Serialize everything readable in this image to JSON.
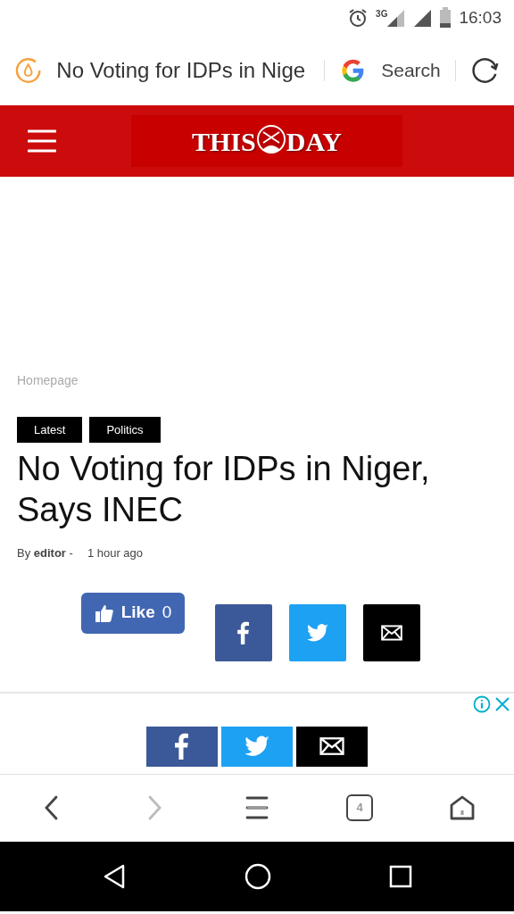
{
  "status_bar": {
    "network": "3G",
    "time": "16:03"
  },
  "address_bar": {
    "title": "No Voting for IDPs in Nige",
    "search": "Search"
  },
  "site_header": {
    "logo_left": "THIS",
    "logo_right": "DAY"
  },
  "breadcrumb": "Homepage",
  "tags": [
    "Latest",
    "Politics"
  ],
  "title": "No Voting for IDPs in Niger, Says INEC",
  "byline": {
    "author": "By **editor** -",
    "time": "1 hour ago"
  },
  "like_button": {
    "label": "Like",
    "count": "0"
  },
  "share_buttons": [
    {
      "kind": "facebook"
    },
    {
      "kind": "twitter"
    },
    {
      "kind": "email"
    }
  ],
  "ad_share_buttons": [
    {
      "kind": "facebook"
    },
    {
      "kind": "twitter"
    },
    {
      "kind": "email"
    }
  ],
  "browser_nav": [
    {
      "kind": "back",
      "disabled": false
    },
    {
      "kind": "forward",
      "disabled": true
    },
    {
      "kind": "menu",
      "disabled": false
    },
    {
      "kind": "tabs",
      "disabled": false,
      "count": "4"
    },
    {
      "kind": "home",
      "disabled": false
    }
  ]
}
